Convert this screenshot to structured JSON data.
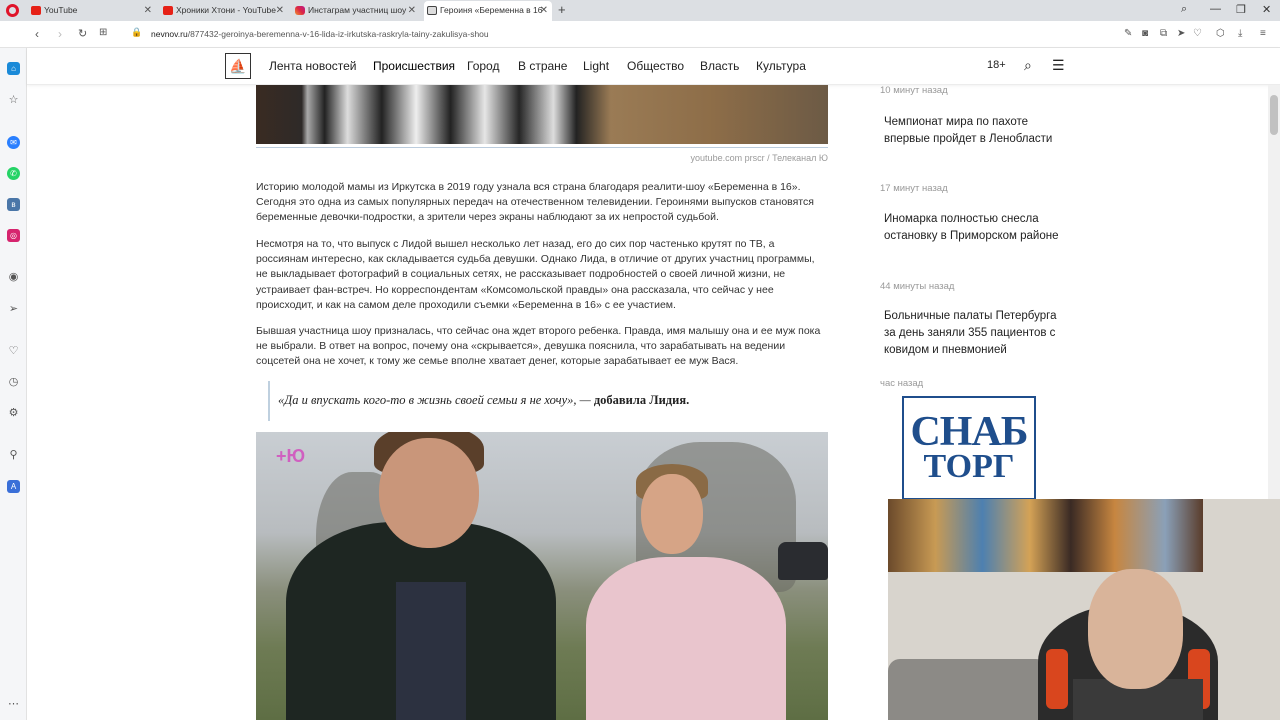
{
  "browser": {
    "tabs": [
      {
        "title": "YouTube",
        "favicon": "youtube-favicon",
        "active": false
      },
      {
        "title": "Хроники Хтони - YouTube",
        "favicon": "youtube-favicon",
        "active": false
      },
      {
        "title": "Инстаграм участниц шоу",
        "favicon": "instagram-favicon",
        "active": false
      },
      {
        "title": "Героиня «Беременна в 16",
        "favicon": "nevnov-favicon",
        "active": true
      }
    ],
    "url_domain": "nevnov.ru",
    "url_path": "/877432-geroinya-beremenna-v-16-lida-iz-irkutska-raskryla-tainy-zakulisya-shou"
  },
  "site": {
    "nav": [
      "Лента новостей",
      "Происшествия",
      "Город",
      "В стране",
      "Light",
      "Общество",
      "Власть",
      "Культура"
    ],
    "age_label": "18+",
    "accent": "#1f4e8c"
  },
  "article": {
    "photo_caption": "youtube.com prscr / Телеканал Ю",
    "p1": "Историю молодой мамы из Иркутска в 2019 году узнала вся страна благодаря реалити-шоу «Беременна в 16». Сегодня это одна из самых популярных передач на отечественном телевидении. Героинями выпусков становятся беременные девочки-подростки, а зрители через экраны наблюдают за их непростой судьбой.",
    "p2": "Несмотря на то, что выпуск с Лидой вышел несколько лет назад, его до сих пор частенько крутят по ТВ, а россиянам интересно, как складывается судьба девушки. Однако Лида, в отличие от других участниц программы, не выкладывает фотографий в социальных сетях, не рассказывает подробностей о своей личной жизни, не устраивает фан-встреч. Но корреспондентам «Комсомольской правды» она рассказала, что сейчас у нее происходит, и как на самом деле проходили съемки «Беременна в 16» с ее участием.",
    "p3": "Бывшая участница шоу призналась, что сейчас она ждет второго ребенка. Правда, имя малышу она и ее муж пока не выбрали. В ответ на вопрос, почему она «скрывается», девушка пояснила, что зарабатывать на ведении соцсетей она не хочет, к тому же семье вполне хватает денег, которые зарабатывает ее муж Вася.",
    "quote_text": "«Да и впускать кого-то в жизнь своей семьи я не хочу», —",
    "quote_by": "добавила Лидия.",
    "tv_logo": "+Ю"
  },
  "feed": [
    {
      "time": "10 минут назад",
      "title": "Чемпионат мира по пахоте впервые пройдет в Ленобласти"
    },
    {
      "time": "17 минут назад",
      "title": "Иномарка полностью снесла остановку в Приморском районе"
    },
    {
      "time": "44 минуты назад",
      "title": "Больничные палаты Петербурга за день заняли 355 пациентов с ковидом и пневмонией"
    },
    {
      "time": "час назад",
      "title": ""
    }
  ],
  "ad": {
    "line1": "СНАБ",
    "line2": "ТОРГ"
  }
}
